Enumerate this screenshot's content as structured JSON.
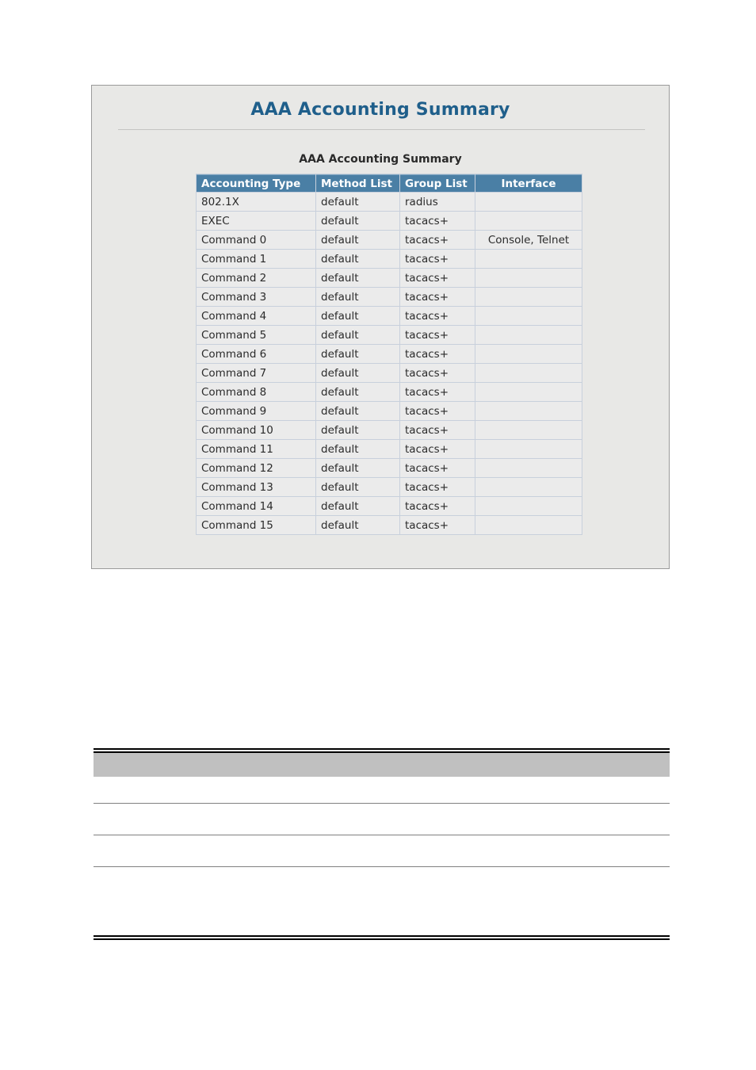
{
  "panel": {
    "title": "AAA Accounting Summary",
    "table_caption": "AAA Accounting Summary"
  },
  "accounting_table": {
    "columns": [
      "Accounting Type",
      "Method List",
      "Group List",
      "Interface"
    ],
    "rows": [
      {
        "type": "802.1X",
        "method": "default",
        "group": "radius",
        "interface": ""
      },
      {
        "type": "EXEC",
        "method": "default",
        "group": "tacacs+",
        "interface": ""
      },
      {
        "type": "Command 0",
        "method": "default",
        "group": "tacacs+",
        "interface": "Console, Telnet"
      },
      {
        "type": "Command 1",
        "method": "default",
        "group": "tacacs+",
        "interface": ""
      },
      {
        "type": "Command 2",
        "method": "default",
        "group": "tacacs+",
        "interface": ""
      },
      {
        "type": "Command 3",
        "method": "default",
        "group": "tacacs+",
        "interface": ""
      },
      {
        "type": "Command 4",
        "method": "default",
        "group": "tacacs+",
        "interface": ""
      },
      {
        "type": "Command 5",
        "method": "default",
        "group": "tacacs+",
        "interface": ""
      },
      {
        "type": "Command 6",
        "method": "default",
        "group": "tacacs+",
        "interface": ""
      },
      {
        "type": "Command 7",
        "method": "default",
        "group": "tacacs+",
        "interface": ""
      },
      {
        "type": "Command 8",
        "method": "default",
        "group": "tacacs+",
        "interface": ""
      },
      {
        "type": "Command 9",
        "method": "default",
        "group": "tacacs+",
        "interface": ""
      },
      {
        "type": "Command 10",
        "method": "default",
        "group": "tacacs+",
        "interface": ""
      },
      {
        "type": "Command 11",
        "method": "default",
        "group": "tacacs+",
        "interface": ""
      },
      {
        "type": "Command 12",
        "method": "default",
        "group": "tacacs+",
        "interface": ""
      },
      {
        "type": "Command 13",
        "method": "default",
        "group": "tacacs+",
        "interface": ""
      },
      {
        "type": "Command 14",
        "method": "default",
        "group": "tacacs+",
        "interface": ""
      },
      {
        "type": "Command 15",
        "method": "default",
        "group": "tacacs+",
        "interface": ""
      }
    ]
  },
  "colors": {
    "title_blue": "#1f5f8b",
    "table_header_blue": "#4a7fa5",
    "cell_gray": "#ebebeb",
    "panel_background": "#e8e8e6",
    "doc_header_band": "#c0c0c0"
  }
}
